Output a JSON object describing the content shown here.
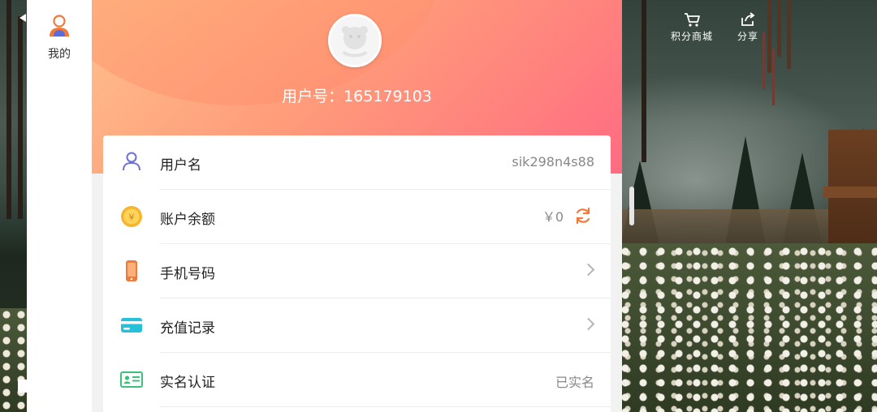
{
  "side_menu": {
    "my_tab_label": "我的"
  },
  "header": {
    "user_id_line": "用户号：165179103"
  },
  "top_actions": {
    "points_mall": "积分商城",
    "share": "分享"
  },
  "rows": {
    "username": {
      "label": "用户名",
      "value": "sik298n4s88"
    },
    "balance": {
      "label": "账户余额",
      "value": "￥0"
    },
    "phone": {
      "label": "手机号码"
    },
    "recharge": {
      "label": "充值记录"
    },
    "verification": {
      "label": "实名认证",
      "value": "已实名"
    }
  },
  "colors": {
    "hero_gradient_start": "#ffc08c",
    "hero_gradient_end": "#ff6b82",
    "user_icon": "#6b6fd6",
    "coin_icon": "#f5b52e",
    "phone_icon": "#f07a3a",
    "card_icon": "#26c0d8",
    "id_icon": "#3ac27a",
    "refresh_icon": "#f07a3a"
  },
  "icons": {
    "my_tab": "user-silhouette-icon",
    "avatar": "avatar-default-icon",
    "username": "user-outline-icon",
    "balance": "coin-icon",
    "balance_action": "refresh-icon",
    "phone": "mobile-phone-icon",
    "recharge": "credit-card-icon",
    "verification": "id-card-icon",
    "points_mall": "shopping-cart-icon",
    "share": "share-icon"
  }
}
